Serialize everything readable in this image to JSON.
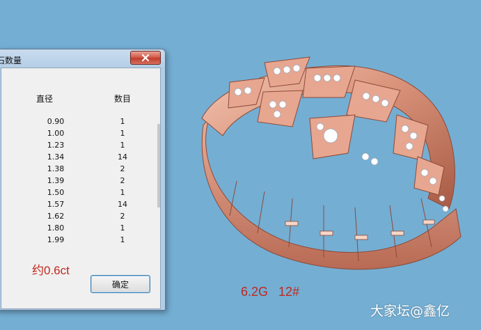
{
  "dialog": {
    "title": "石数量",
    "columns": {
      "diameter": "直径",
      "count": "数目"
    },
    "rows": [
      {
        "diameter": "0.90",
        "count": "1"
      },
      {
        "diameter": "1.00",
        "count": "1"
      },
      {
        "diameter": "1.23",
        "count": "1"
      },
      {
        "diameter": "1.34",
        "count": "14"
      },
      {
        "diameter": "1.38",
        "count": "2"
      },
      {
        "diameter": "1.39",
        "count": "2"
      },
      {
        "diameter": "1.50",
        "count": "1"
      },
      {
        "diameter": "1.57",
        "count": "14"
      },
      {
        "diameter": "1.62",
        "count": "2"
      },
      {
        "diameter": "1.80",
        "count": "1"
      },
      {
        "diameter": "1.99",
        "count": "1"
      }
    ],
    "note": "约0.6ct",
    "ok_label": "确定",
    "close_icon": "close-icon"
  },
  "ring": {
    "caption": "6.2G   12#",
    "image_icon": "serpent-ring-icon"
  },
  "watermark": "大家坛@鑫亿",
  "colors": {
    "desktop": "#74aed3",
    "annotation_red": "#c0281e",
    "rose_gold": "#d9937a"
  }
}
